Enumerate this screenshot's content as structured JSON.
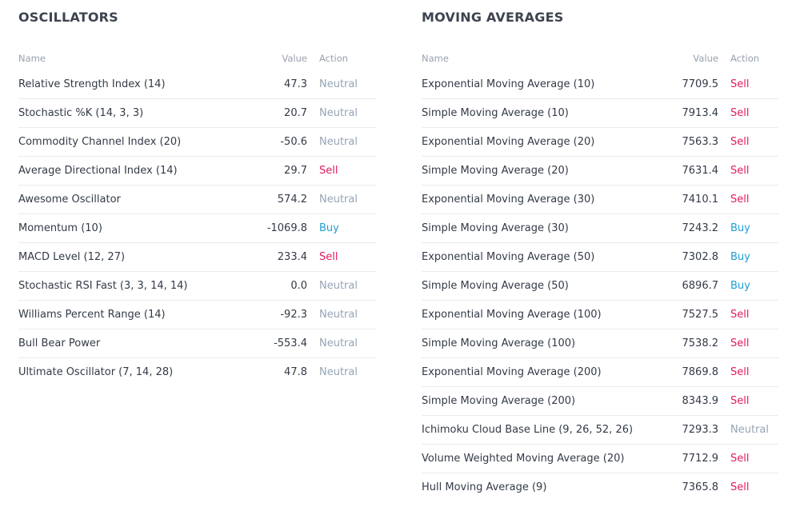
{
  "colors": {
    "sell": "#e31b5a",
    "buy": "#1e9fd4",
    "neutral": "#96a5b5",
    "heading": "#3d4350",
    "column_header": "#98a1ae"
  },
  "oscillators": {
    "title": "OSCILLATORS",
    "columns": {
      "name": "Name",
      "value": "Value",
      "action": "Action"
    },
    "rows": [
      {
        "name": "Relative Strength Index (14)",
        "value": "47.3",
        "action": "Neutral"
      },
      {
        "name": "Stochastic %K (14, 3, 3)",
        "value": "20.7",
        "action": "Neutral"
      },
      {
        "name": "Commodity Channel Index (20)",
        "value": "-50.6",
        "action": "Neutral"
      },
      {
        "name": "Average Directional Index (14)",
        "value": "29.7",
        "action": "Sell"
      },
      {
        "name": "Awesome Oscillator",
        "value": "574.2",
        "action": "Neutral"
      },
      {
        "name": "Momentum (10)",
        "value": "-1069.8",
        "action": "Buy"
      },
      {
        "name": "MACD Level (12, 27)",
        "value": "233.4",
        "action": "Sell"
      },
      {
        "name": "Stochastic RSI Fast (3, 3, 14, 14)",
        "value": "0.0",
        "action": "Neutral"
      },
      {
        "name": "Williams Percent Range (14)",
        "value": "-92.3",
        "action": "Neutral"
      },
      {
        "name": "Bull Bear Power",
        "value": "-553.4",
        "action": "Neutral"
      },
      {
        "name": "Ultimate Oscillator (7, 14, 28)",
        "value": "47.8",
        "action": "Neutral"
      }
    ]
  },
  "moving_averages": {
    "title": "MOVING AVERAGES",
    "columns": {
      "name": "Name",
      "value": "Value",
      "action": "Action"
    },
    "rows": [
      {
        "name": "Exponential Moving Average (10)",
        "value": "7709.5",
        "action": "Sell"
      },
      {
        "name": "Simple Moving Average (10)",
        "value": "7913.4",
        "action": "Sell"
      },
      {
        "name": "Exponential Moving Average (20)",
        "value": "7563.3",
        "action": "Sell"
      },
      {
        "name": "Simple Moving Average (20)",
        "value": "7631.4",
        "action": "Sell"
      },
      {
        "name": "Exponential Moving Average (30)",
        "value": "7410.1",
        "action": "Sell"
      },
      {
        "name": "Simple Moving Average (30)",
        "value": "7243.2",
        "action": "Buy"
      },
      {
        "name": "Exponential Moving Average (50)",
        "value": "7302.8",
        "action": "Buy"
      },
      {
        "name": "Simple Moving Average (50)",
        "value": "6896.7",
        "action": "Buy"
      },
      {
        "name": "Exponential Moving Average (100)",
        "value": "7527.5",
        "action": "Sell"
      },
      {
        "name": "Simple Moving Average (100)",
        "value": "7538.2",
        "action": "Sell"
      },
      {
        "name": "Exponential Moving Average (200)",
        "value": "7869.8",
        "action": "Sell"
      },
      {
        "name": "Simple Moving Average (200)",
        "value": "8343.9",
        "action": "Sell"
      },
      {
        "name": "Ichimoku Cloud Base Line (9, 26, 52, 26)",
        "value": "7293.3",
        "action": "Neutral"
      },
      {
        "name": "Volume Weighted Moving Average (20)",
        "value": "7712.9",
        "action": "Sell"
      },
      {
        "name": "Hull Moving Average (9)",
        "value": "7365.8",
        "action": "Sell"
      }
    ]
  }
}
